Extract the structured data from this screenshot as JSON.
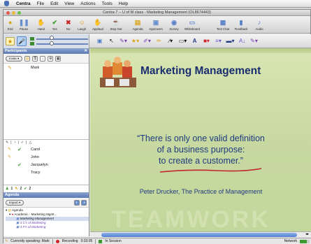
{
  "menubar": {
    "app": "Centra",
    "items": [
      "File",
      "Edit",
      "View",
      "Actions",
      "Tools",
      "Help"
    ]
  },
  "window": {
    "title": "Centra 7 -- U of M class - Marketing Management (OL8674443)"
  },
  "toolbar": {
    "buttons": [
      {
        "label": "End",
        "icon": "lightbulb-icon"
      },
      {
        "label": "Pause",
        "icon": "pause-icon"
      },
      {
        "label": "Hand",
        "icon": "hand-icon"
      },
      {
        "label": "Yes",
        "icon": "check-icon"
      },
      {
        "label": "No",
        "icon": "x-icon"
      },
      {
        "label": "Laugh",
        "icon": "laugh-icon"
      },
      {
        "label": "Applaud",
        "icon": "applaud-icon"
      },
      {
        "label": "Step Out",
        "icon": "step-out-icon"
      },
      {
        "label": "Agenda",
        "icon": "agenda-icon"
      },
      {
        "label": "Approvers",
        "icon": "approvers-icon"
      },
      {
        "label": "Survey",
        "icon": "survey-icon"
      },
      {
        "label": "Whiteboard",
        "icon": "whiteboard-icon"
      },
      {
        "label": "Text Chat",
        "icon": "text-chat-icon"
      },
      {
        "label": "Feedback",
        "icon": "feedback-icon"
      },
      {
        "label": "Audio",
        "icon": "audio-icon"
      }
    ]
  },
  "participants": {
    "header": "Participants",
    "invite_label": "Invite",
    "self_name": "Mark",
    "people": [
      "Carol",
      "John",
      "Jacquelyn",
      "Tracy"
    ],
    "counts": [
      "1",
      "2",
      "2"
    ]
  },
  "agenda": {
    "header": "Agenda",
    "import_label": "Import",
    "root": "Agenda",
    "course": "Academic - Marketing Mgmt...",
    "items": [
      "Marketing Management",
      "3 C's of Marketing",
      "4 P's of Marketing"
    ]
  },
  "slide": {
    "title": "Marketing Management",
    "quote_lines": [
      "“There is only one valid definition",
      "of a business purpose:",
      "to create a customer.”"
    ],
    "attribution": "Peter Drucker, The Practice of Management",
    "watermark": "TEAMWORK"
  },
  "statusbar": {
    "speaking": "Currently speaking: Mark",
    "recording": "Recording",
    "time": "0:33:05",
    "session": "In Session",
    "network": "Network"
  },
  "colors": {
    "accent": "#5a79b4",
    "slide_bg": "#c7d9a0",
    "title_blue": "#1a2e6f",
    "underline_red": "#c0262a"
  }
}
